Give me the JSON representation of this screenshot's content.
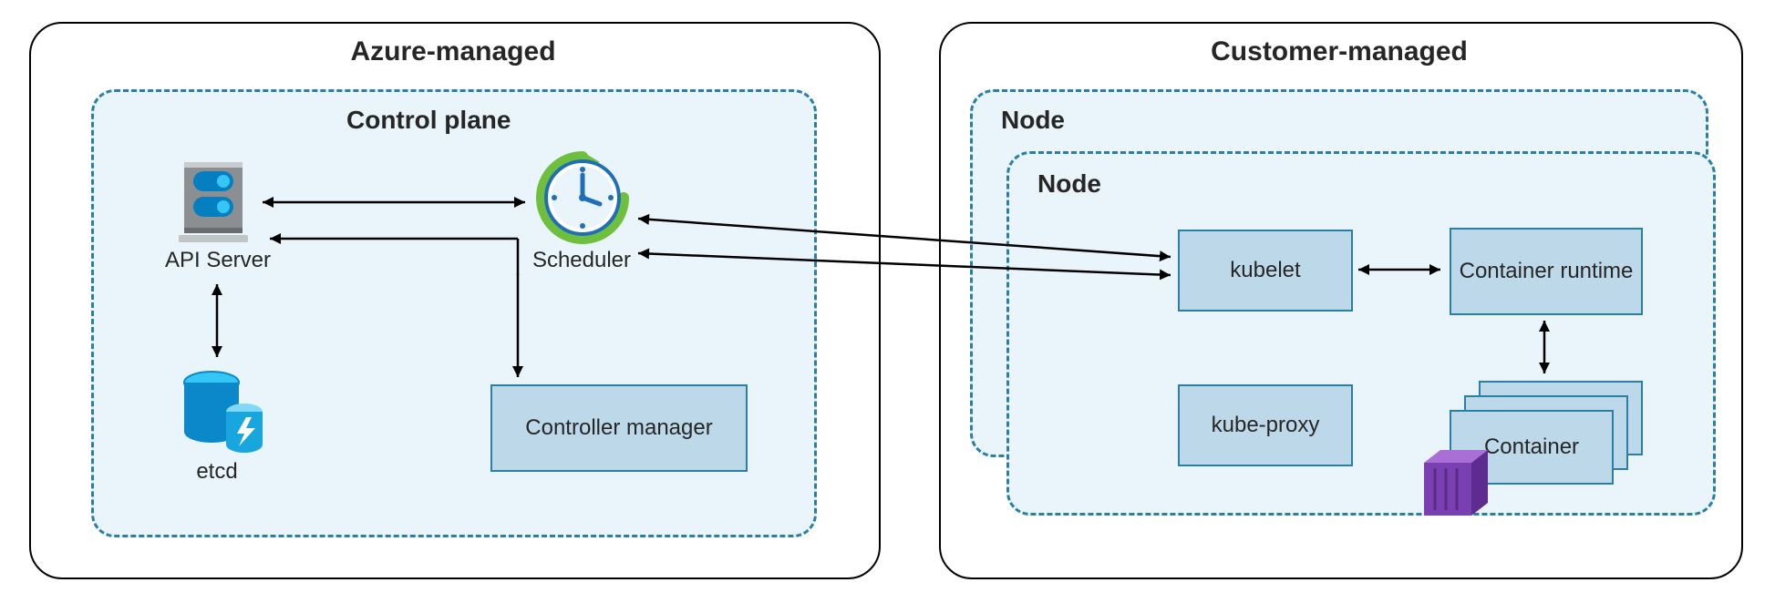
{
  "diagram": {
    "left_panel_title": "Azure-managed",
    "right_panel_title": "Customer-managed",
    "control_plane_title": "Control plane",
    "node_back_title": "Node",
    "node_front_title": "Node",
    "api_server_label": "API Server",
    "scheduler_label": "Scheduler",
    "etcd_label": "etcd",
    "controller_manager_label": "Controller manager",
    "kubelet_label": "kubelet",
    "kube_proxy_label": "kube-proxy",
    "container_runtime_label": "Container runtime",
    "container_label": "Container"
  }
}
